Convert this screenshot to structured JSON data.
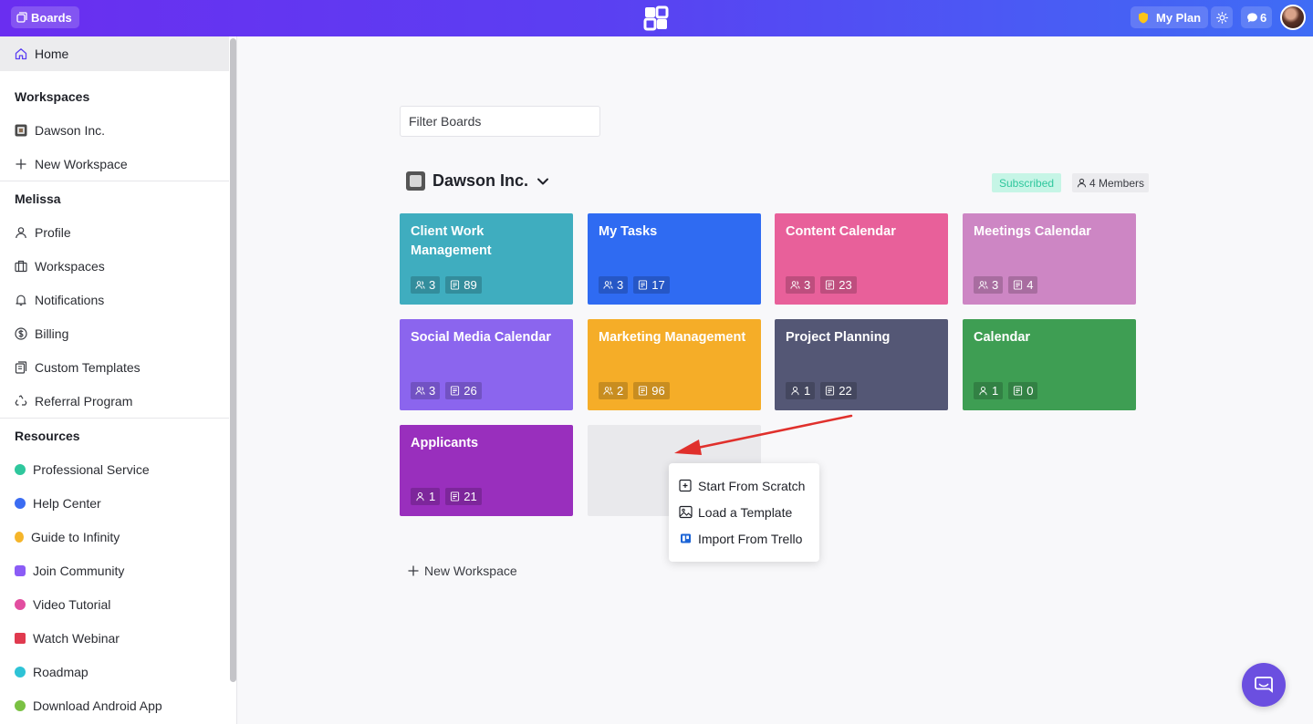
{
  "topbar": {
    "boards_label": "Boards",
    "plan_label": "My Plan",
    "chat_count": "6",
    "gradient_start": "#6a2ef0",
    "gradient_end": "#3f6cf5"
  },
  "sidebar": {
    "home": "Home",
    "workspaces_heading": "Workspaces",
    "workspace_name": "Dawson Inc.",
    "new_workspace": "New Workspace",
    "user_heading": "Melissa",
    "user_items": [
      {
        "label": "Profile",
        "icon": "user-icon"
      },
      {
        "label": "Workspaces",
        "icon": "briefcase-icon"
      },
      {
        "label": "Notifications",
        "icon": "bell-icon"
      },
      {
        "label": "Billing",
        "icon": "dollar-icon"
      },
      {
        "label": "Custom Templates",
        "icon": "template-icon"
      },
      {
        "label": "Referral Program",
        "icon": "recycle-icon"
      }
    ],
    "resources_heading": "Resources",
    "resources": [
      {
        "label": "Professional Service",
        "color": "#2fc79d"
      },
      {
        "label": "Help Center",
        "color": "#3b6cf2"
      },
      {
        "label": "Guide to Infinity",
        "color": "#f5b52a"
      },
      {
        "label": "Join Community",
        "color": "#8b5cf6"
      },
      {
        "label": "Video Tutorial",
        "color": "#e24ea0"
      },
      {
        "label": "Watch Webinar",
        "color": "#e03a4f"
      },
      {
        "label": "Roadmap",
        "color": "#2ec3d6"
      },
      {
        "label": "Download Android App",
        "color": "#7ac143"
      }
    ]
  },
  "main": {
    "filter_placeholder": "Filter Boards",
    "workspace_title": "Dawson Inc.",
    "subscribed": "Subscribed",
    "members": "4 Members",
    "boards": [
      {
        "title": "Client Work Management",
        "members": "3",
        "items": "89",
        "color": "#3fadbf"
      },
      {
        "title": "My Tasks",
        "members": "3",
        "items": "17",
        "color": "#2f6bf2"
      },
      {
        "title": "Content Calendar",
        "members": "3",
        "items": "23",
        "color": "#e8609a"
      },
      {
        "title": "Meetings Calendar",
        "members": "3",
        "items": "4",
        "color": "#cd86c4"
      },
      {
        "title": "Social Media Calendar",
        "members": "3",
        "items": "26",
        "color": "#8b65ee"
      },
      {
        "title": "Marketing Management",
        "members": "2",
        "items": "96",
        "color": "#f5ad28"
      },
      {
        "title": "Project Planning",
        "members": "1",
        "items": "22",
        "color": "#545775"
      },
      {
        "title": "Calendar",
        "members": "1",
        "items": "0",
        "color": "#3e9e53"
      },
      {
        "title": "Applicants",
        "members": "1",
        "items": "21",
        "color": "#992fbd"
      }
    ],
    "menu": [
      {
        "label": "Start From Scratch",
        "icon": "add-square-icon"
      },
      {
        "label": "Load a Template",
        "icon": "image-icon"
      },
      {
        "label": "Import From Trello",
        "icon": "trello-icon"
      }
    ],
    "new_workspace": "New Workspace"
  }
}
